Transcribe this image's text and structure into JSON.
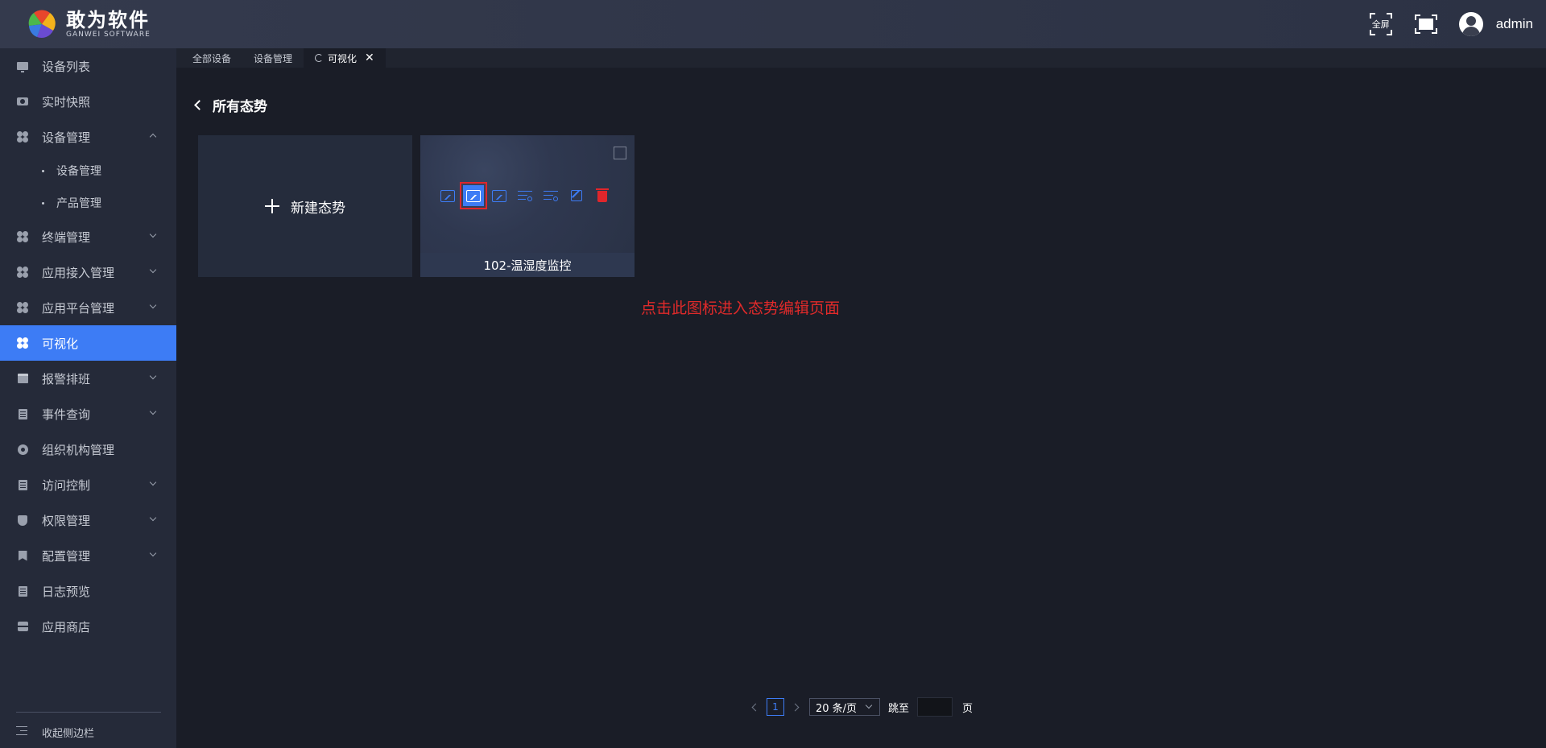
{
  "header": {
    "logo_cn": "敢为软件",
    "logo_en": "GANWEI SOFTWARE",
    "fullscreen_label": "全屏",
    "username": "admin"
  },
  "sidebar": {
    "items": [
      {
        "label": "设备列表",
        "icon": "monitor-icon"
      },
      {
        "label": "实时快照",
        "icon": "camera-icon"
      },
      {
        "label": "设备管理",
        "icon": "clover-icon",
        "expanded": true,
        "children": [
          {
            "label": "设备管理"
          },
          {
            "label": "产品管理"
          }
        ]
      },
      {
        "label": "终端管理",
        "icon": "clover-icon"
      },
      {
        "label": "应用接入管理",
        "icon": "clover-icon"
      },
      {
        "label": "应用平台管理",
        "icon": "clover-icon"
      },
      {
        "label": "可视化",
        "icon": "clover-icon",
        "active": true
      },
      {
        "label": "报警排班",
        "icon": "calendar-icon"
      },
      {
        "label": "事件查询",
        "icon": "doc-icon"
      },
      {
        "label": "组织机构管理",
        "icon": "gear-icon"
      },
      {
        "label": "访问控制",
        "icon": "doc-icon"
      },
      {
        "label": "权限管理",
        "icon": "shield-icon"
      },
      {
        "label": "配置管理",
        "icon": "bookmark-icon"
      },
      {
        "label": "日志预览",
        "icon": "doc-icon"
      },
      {
        "label": "应用商店",
        "icon": "store-icon"
      }
    ],
    "collapse_label": "收起侧边栏"
  },
  "tabs": [
    {
      "label": "全部设备"
    },
    {
      "label": "设备管理"
    },
    {
      "label": "可视化",
      "active": true
    }
  ],
  "main": {
    "title": "所有态势",
    "new_card_label": "新建态势",
    "cards": [
      {
        "name": "102-温湿度监控"
      }
    ],
    "annotation": "点击此图标进入态势编辑页面"
  },
  "pagination": {
    "current_page": "1",
    "page_size": "20 条/页",
    "jump_label": "跳至",
    "page_label": "页",
    "jump_value": ""
  },
  "colors": {
    "accent": "#3d7cf5",
    "danger": "#e0262b",
    "annotation": "#e02a2a"
  }
}
